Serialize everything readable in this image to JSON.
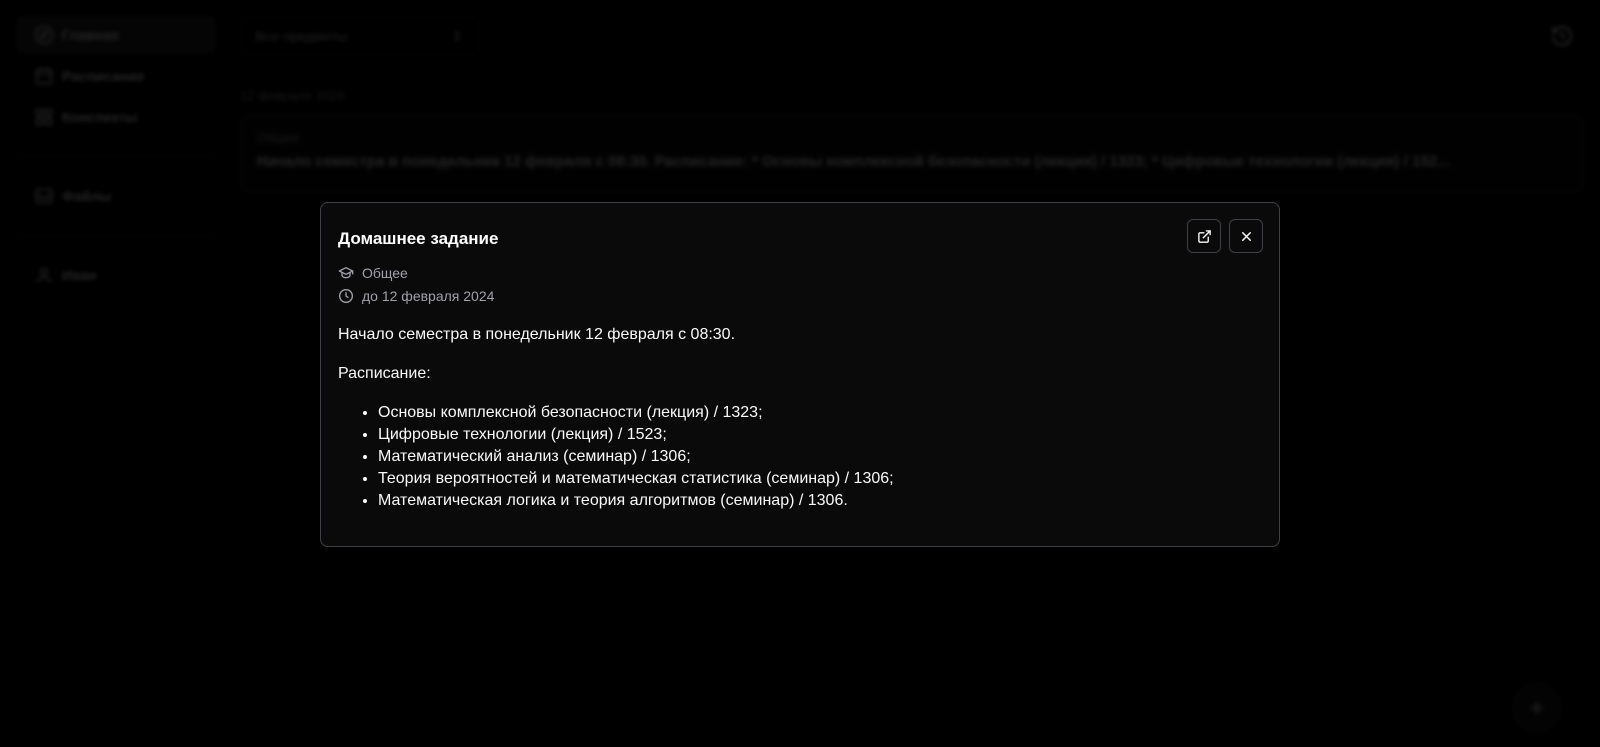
{
  "sidebar": {
    "items": [
      {
        "label": "Главная",
        "icon": "compass-icon",
        "active": true
      },
      {
        "label": "Расписание",
        "icon": "calendar-icon"
      },
      {
        "label": "Конспекты",
        "icon": "grid-icon"
      },
      {
        "label": "Файлы",
        "icon": "inbox-icon"
      },
      {
        "label": "Иван",
        "icon": "user-icon"
      }
    ]
  },
  "header": {
    "subject_filter": "Все предметы",
    "history_icon": "history-icon"
  },
  "feed": {
    "date": "12 февраля 2024",
    "card": {
      "subject": "Общее",
      "text": "Начало семестра в понедельник 12 февраля с 08:30. Расписание: * Основы комплексной безопасности (лекция) / 1323; * Цифровые технологии (лекция) / 152..."
    }
  },
  "fab": {
    "label": "+"
  },
  "modal": {
    "title": "Домашнее задание",
    "subject": "Общее",
    "due": "до 12 февраля 2024",
    "intro": "Начало семестра в понедельник 12 февраля с 08:30.",
    "schedule_heading": "Расписание:",
    "items": [
      "Основы комплексной безопасности (лекция) / 1323;",
      "Цифровые технологии (лекция) / 1523;",
      "Математический анализ (семинар) / 1306;",
      "Теория вероятностей и математическая статистика (семинар) / 1306;",
      "Математическая логика и теория алгоритмов (семинар) / 1306."
    ]
  },
  "colors": {
    "background": "#000000",
    "modal_bg": "#0a0a0b",
    "border": "#3f3f46",
    "muted_text": "#a1a1aa"
  }
}
